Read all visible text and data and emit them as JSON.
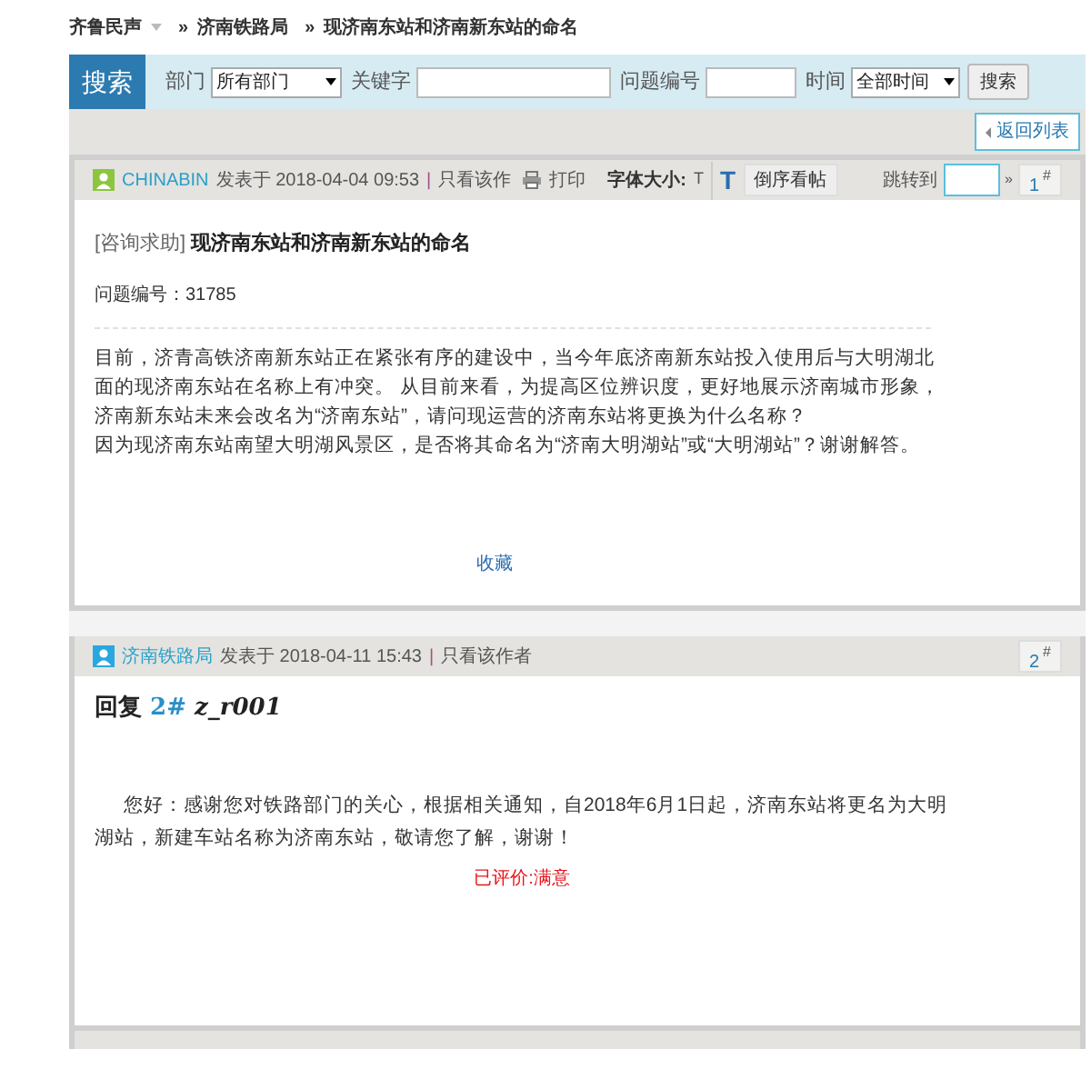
{
  "breadcrumb": [
    {
      "label": "齐鲁民声",
      "dropdown": true
    },
    {
      "separator": "»",
      "label": "济南铁路局",
      "dropdown": false
    },
    {
      "separator": "»",
      "label": "现济南东站和济南新东站的命名",
      "dropdown": false
    }
  ],
  "search": {
    "title": "搜索",
    "fields": [
      {
        "kind": "select",
        "label": "部门",
        "value": "所有部门"
      },
      {
        "kind": "input",
        "label": "关键字"
      },
      {
        "kind": "input",
        "label": "问题编号"
      },
      {
        "kind": "select",
        "label": "时间",
        "value": "全部时间"
      }
    ],
    "button": "搜索"
  },
  "back_button": "返回列表",
  "posts": [
    {
      "author": "CHINABIN",
      "posted": "发表于 2018-04-04 09:53",
      "separator": "|",
      "only_author": "只看该作",
      "print": "打印",
      "font_size_label": "字体大小:",
      "font_small": "T",
      "font_large": "T",
      "reverse_button": "倒序看帖",
      "jump_label": "跳转到",
      "jump_arrow": "»",
      "floor": "1",
      "floor_mark": "#",
      "kind": "question",
      "category": "[咨询求助]",
      "title": "现济南东站和济南新东站的命名",
      "number": "问题编号：31785",
      "paragraphs": [
        "目前，济青高铁济南新东站正在紧张有序的建设中，当今年底济南新东站投入使用后与大明湖北面的现济南东站在名称上有冲突。 从目前来看，为提高区位辨识度，更好地展示济南城市形象，济南新东站未来会改名为“济南东站”，请问现运营的济南东站将更换为什么名称？",
        "因为现济南东站南望大明湖风景区，是否将其命名为“济南大明湖站”或“大明湖站”？谢谢解答。"
      ],
      "favorite": "收藏"
    },
    {
      "author": "济南铁路局",
      "posted": "发表于 2018-04-11 15:43",
      "separator": "|",
      "only_author": "只看该作者",
      "floor": "2",
      "floor_mark": "#",
      "kind": "reply",
      "reply_label": "回复",
      "reply_floor": "2#",
      "reply_user": "z_r001",
      "paragraphs": [
        "您好：感谢您对铁路部门的关心，根据相关通知，自2018年6月1日起，济南东站将更名为大明湖站，新建车站名称为济南东站，敬请您了解，谢谢！"
      ],
      "rating": "已评价:满意"
    }
  ]
}
